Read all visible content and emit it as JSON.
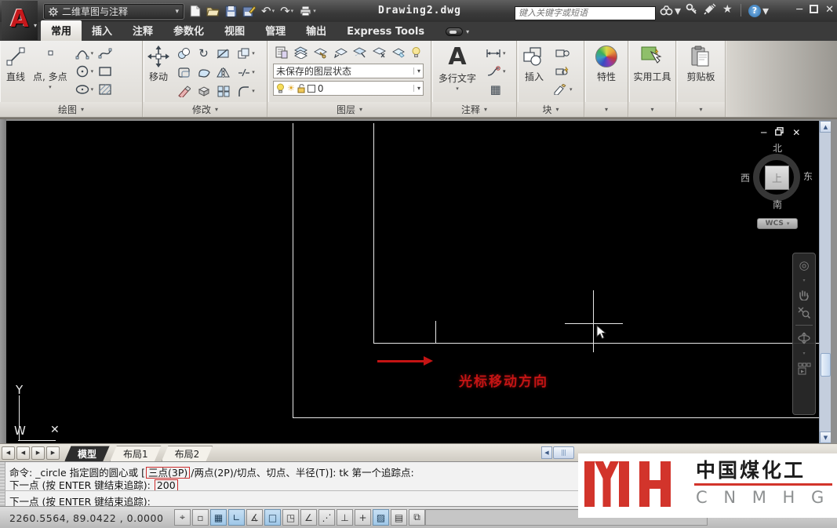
{
  "titlebar": {
    "workspace": "二维草图与注释",
    "title": "Drawing2.dwg",
    "search_placeholder": "键入关键字或短语"
  },
  "ribbon_tabs": [
    {
      "label": "常用"
    },
    {
      "label": "插入"
    },
    {
      "label": "注释"
    },
    {
      "label": "参数化"
    },
    {
      "label": "视图"
    },
    {
      "label": "管理"
    },
    {
      "label": "输出"
    },
    {
      "label": "Express Tools"
    }
  ],
  "ribbon": {
    "draw": {
      "label": "绘图",
      "line": "直线",
      "point": "点, 多点"
    },
    "modify": {
      "label": "修改",
      "move": "移动"
    },
    "layers": {
      "label": "图层",
      "state": "未保存的图层状态",
      "layer": "0"
    },
    "annotate": {
      "label": "注释",
      "mtext": "多行文字",
      "a_glyph": "A"
    },
    "block": {
      "label": "块",
      "insert": "插入"
    },
    "props": {
      "label": "特性"
    },
    "utils": {
      "label": "实用工具"
    },
    "clip": {
      "label": "剪贴板"
    }
  },
  "viewport": {
    "compass": {
      "n": "北",
      "s": "南",
      "w": "西",
      "e": "东",
      "top": "上",
      "wcs": "WCS"
    },
    "ucs": {
      "y": "Y",
      "w": "W",
      "x": "✕"
    },
    "note": "光标移动方向"
  },
  "layout_tabs": [
    {
      "label": "模型"
    },
    {
      "label": "布局1"
    },
    {
      "label": "布局2"
    }
  ],
  "command": {
    "line1_pre": "命令: _circle 指定圆的圆心或 [",
    "line1_box": "三点(3P)",
    "line1_post": "/两点(2P)/切点、切点、半径(T)]: tk 第一个追踪点:",
    "line2_pre": "下一点 (按 ENTER 键结束追踪): ",
    "line2_box": "200",
    "line3": "下一点 (按 ENTER 键结束追踪):"
  },
  "statusbar": {
    "coords": "2260.5564, 89.0422 ,  0.0000",
    "buttons": [
      {
        "glyph": "⌖",
        "active": false
      },
      {
        "glyph": "▫",
        "active": false
      },
      {
        "glyph": "▦",
        "active": true
      },
      {
        "glyph": "∟",
        "active": true
      },
      {
        "glyph": "∡",
        "active": false
      },
      {
        "glyph": "□",
        "active": true
      },
      {
        "glyph": "◳",
        "active": false
      },
      {
        "glyph": "∠",
        "active": false
      },
      {
        "glyph": "⋰",
        "active": false
      },
      {
        "glyph": "⊥",
        "active": false
      },
      {
        "glyph": "+",
        "active": false
      },
      {
        "glyph": "▨",
        "active": true
      },
      {
        "glyph": "▤",
        "active": false
      },
      {
        "glyph": "⧉",
        "active": false
      }
    ]
  },
  "watermark": {
    "cn": "中国煤化工",
    "en": "C N M H G"
  },
  "icons": {
    "dropdown": "▾",
    "left": "◀",
    "right": "▶",
    "up": "▲",
    "down": "▼",
    "minimize": "─",
    "close": "✕",
    "help": "?",
    "star": "★",
    "rotate": "↻",
    "undo": "↶",
    "redo": "↷",
    "table": "▦",
    "wheel": "◎",
    "sun": "☀"
  },
  "colors": {
    "accent_red": "#c41414",
    "toggle_active": "#9ec7e8",
    "watermark_red": "#d2342b"
  }
}
